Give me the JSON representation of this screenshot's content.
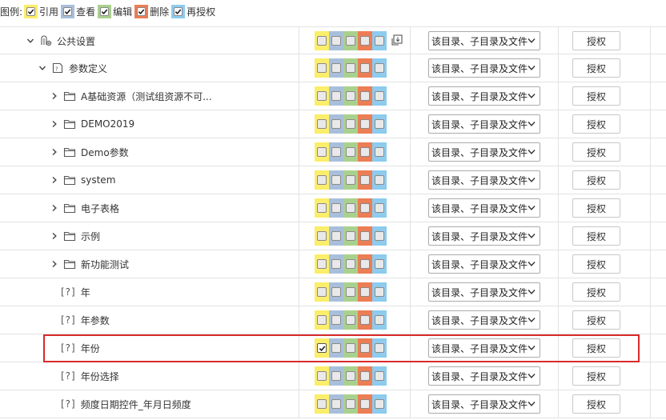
{
  "legend": {
    "title": "图例:",
    "items": [
      {
        "label": "引用",
        "color": "#fbee6a"
      },
      {
        "label": "查看",
        "color": "#a8bfdc"
      },
      {
        "label": "编辑",
        "color": "#a9d18e"
      },
      {
        "label": "删除",
        "color": "#ed7d54"
      },
      {
        "label": "再授权",
        "color": "#8dccef"
      }
    ]
  },
  "perm_colors": [
    "#fbee6a",
    "#a8bfdc",
    "#a9d18e",
    "#ed7d54",
    "#8dccef"
  ],
  "select_text": "该目录、子目录及文件",
  "button_text": "授权",
  "rows": [
    {
      "label": "公共设置",
      "indent": 0,
      "chevron": "down",
      "icon": "public-settings-icon",
      "perms": [
        false,
        false,
        false,
        false,
        false
      ],
      "cascade": true
    },
    {
      "label": "参数定义",
      "indent": 1,
      "chevron": "down",
      "icon": "parameter-definition-icon",
      "perms": [
        false,
        false,
        false,
        false,
        false
      ],
      "cascade": false
    },
    {
      "label": "A基础资源（测试组资源不可...",
      "indent": 2,
      "chevron": "right",
      "icon": "folder-icon",
      "perms": [
        false,
        false,
        false,
        false,
        false
      ],
      "cascade": false
    },
    {
      "label": "DEMO2019",
      "indent": 2,
      "chevron": "right",
      "icon": "folder-icon",
      "perms": [
        false,
        false,
        false,
        false,
        false
      ],
      "cascade": false
    },
    {
      "label": "Demo参数",
      "indent": 2,
      "chevron": "right",
      "icon": "folder-icon",
      "perms": [
        false,
        false,
        false,
        false,
        false
      ],
      "cascade": false
    },
    {
      "label": "system",
      "indent": 2,
      "chevron": "right",
      "icon": "folder-icon",
      "perms": [
        false,
        false,
        false,
        false,
        false
      ],
      "cascade": false
    },
    {
      "label": "电子表格",
      "indent": 2,
      "chevron": "right",
      "icon": "folder-icon",
      "perms": [
        false,
        false,
        false,
        false,
        false
      ],
      "cascade": false
    },
    {
      "label": "示例",
      "indent": 2,
      "chevron": "right",
      "icon": "folder-icon",
      "perms": [
        false,
        false,
        false,
        false,
        false
      ],
      "cascade": false
    },
    {
      "label": "新功能测试",
      "indent": 2,
      "chevron": "right",
      "icon": "folder-icon",
      "perms": [
        false,
        false,
        false,
        false,
        false
      ],
      "cascade": false
    },
    {
      "label": "年",
      "indent": 3,
      "chevron": "none",
      "icon": "parameter-icon",
      "qmark": "[?]",
      "perms": [
        false,
        false,
        false,
        false,
        false
      ],
      "cascade": false
    },
    {
      "label": "年参数",
      "indent": 3,
      "chevron": "none",
      "icon": "parameter-icon",
      "qmark": "[?]",
      "perms": [
        false,
        false,
        false,
        false,
        false
      ],
      "cascade": false
    },
    {
      "label": "年份",
      "indent": 3,
      "chevron": "none",
      "icon": "parameter-icon",
      "qmark": "[?]",
      "perms": [
        true,
        false,
        false,
        false,
        false
      ],
      "cascade": false
    },
    {
      "label": "年份选择",
      "indent": 3,
      "chevron": "none",
      "icon": "parameter-icon",
      "qmark": "[?]",
      "perms": [
        false,
        false,
        false,
        false,
        false
      ],
      "cascade": false
    },
    {
      "label": "频度日期控件_年月日频度",
      "indent": 3,
      "chevron": "none",
      "icon": "parameter-icon",
      "qmark": "[?]",
      "perms": [
        false,
        false,
        false,
        false,
        false
      ],
      "cascade": false
    }
  ]
}
